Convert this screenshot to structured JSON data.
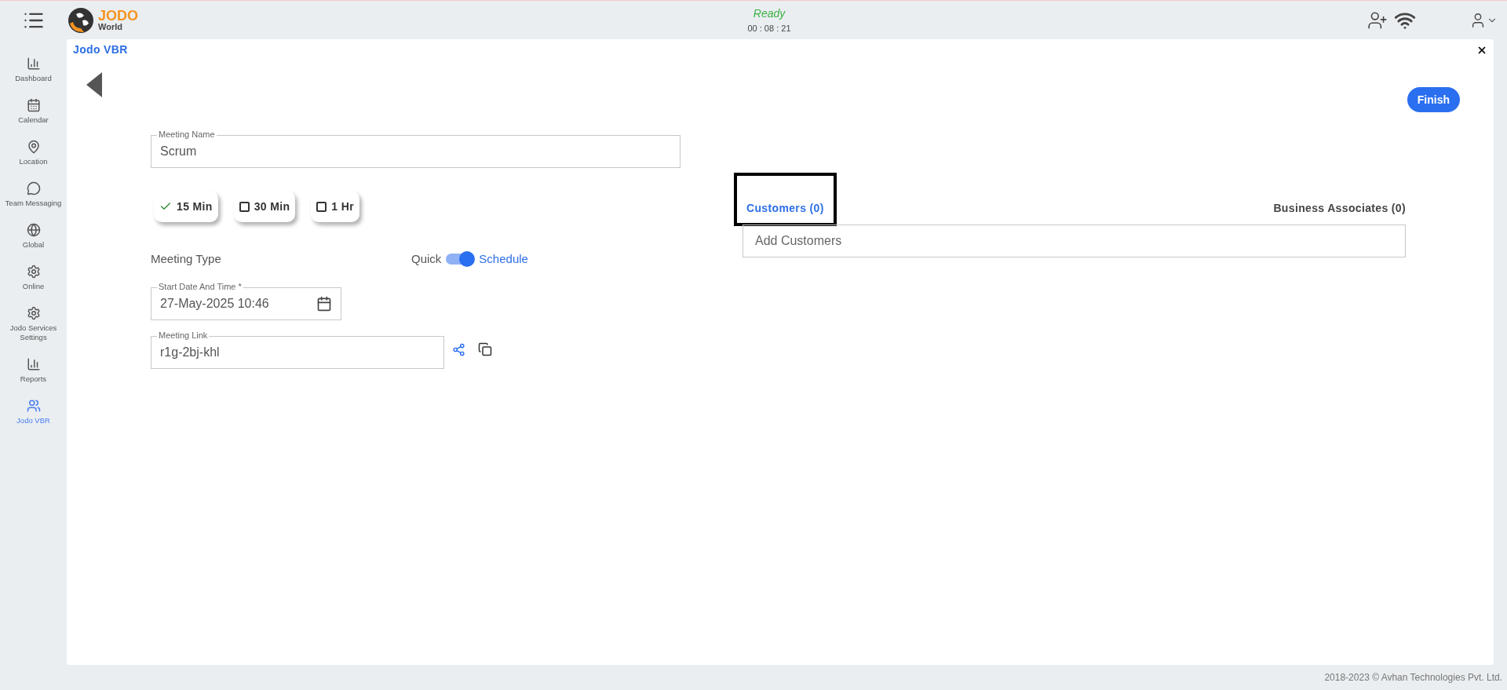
{
  "header": {
    "logo_title": "JODO",
    "logo_subtitle": "World",
    "status": "Ready",
    "timer": "00 : 08 : 21"
  },
  "sidebar": {
    "items": [
      {
        "label": "Dashboard",
        "selected": false
      },
      {
        "label": "Calendar",
        "selected": false
      },
      {
        "label": "Location",
        "selected": false
      },
      {
        "label": "Team Messaging",
        "selected": false
      },
      {
        "label": "Global",
        "selected": false
      },
      {
        "label": "Online",
        "selected": false
      },
      {
        "label": "Jodo Services Settings",
        "selected": false
      },
      {
        "label": "Reports",
        "selected": false
      },
      {
        "label": "Jodo VBR",
        "selected": true
      }
    ]
  },
  "panel": {
    "title": "Jodo VBR",
    "finish": "Finish"
  },
  "form": {
    "meeting_name": {
      "label": "Meeting Name",
      "value": "Scrum"
    },
    "durations": [
      {
        "label": "15 Min",
        "checked": true
      },
      {
        "label": "30 Min",
        "checked": false
      },
      {
        "label": "1 Hr",
        "checked": false
      }
    ],
    "meeting_type": {
      "label": "Meeting Type",
      "off_label": "Quick",
      "on_label": "Schedule",
      "on": true
    },
    "start": {
      "label": "Start Date And Time *",
      "value": "27-May-2025 10:46"
    },
    "link": {
      "label": "Meeting Link",
      "value": "r1g-2bj-khl"
    }
  },
  "tabs": [
    {
      "label": "Customers (0)",
      "selected": true
    },
    {
      "label": "Business Associates (0)",
      "selected": false
    }
  ],
  "search": {
    "placeholder": "Add Customers"
  },
  "footer": "2018-2023 © Avhan Technologies Pvt. Ltd."
}
